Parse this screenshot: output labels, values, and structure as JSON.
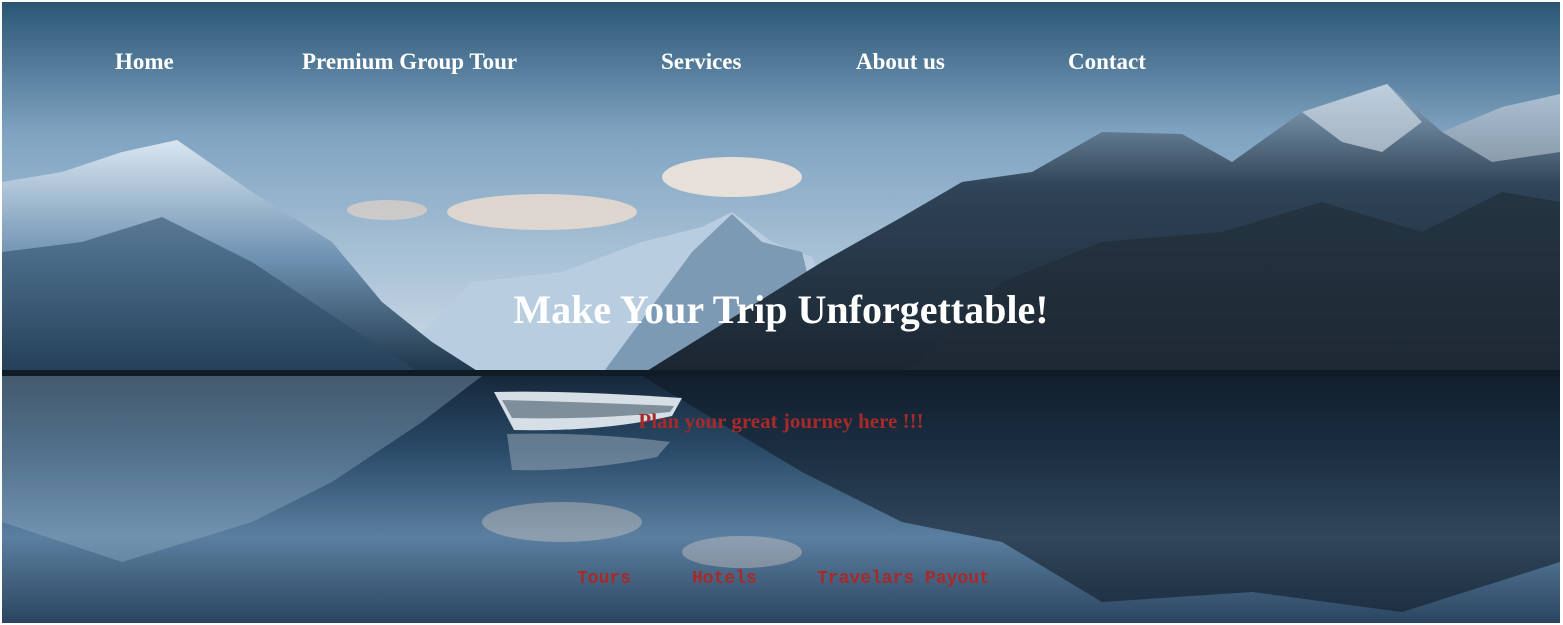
{
  "nav": {
    "items": [
      {
        "label": "Home"
      },
      {
        "label": "Premium Group Tour"
      },
      {
        "label": "Services"
      },
      {
        "label": "About us"
      },
      {
        "label": "Contact"
      }
    ]
  },
  "hero": {
    "headline": "Make Your Trip Unforgettable!",
    "tagline": "Plan your great journey here !!!"
  },
  "subnav": {
    "items": [
      {
        "label": "Tours"
      },
      {
        "label": "Hotels"
      },
      {
        "label": "Travelars Payout"
      }
    ]
  },
  "colors": {
    "nav_text": "#ffffff",
    "headline_text": "#ffffff",
    "accent_red": "#a72a2a"
  },
  "background_image": "mountain-lake-boat-photo"
}
